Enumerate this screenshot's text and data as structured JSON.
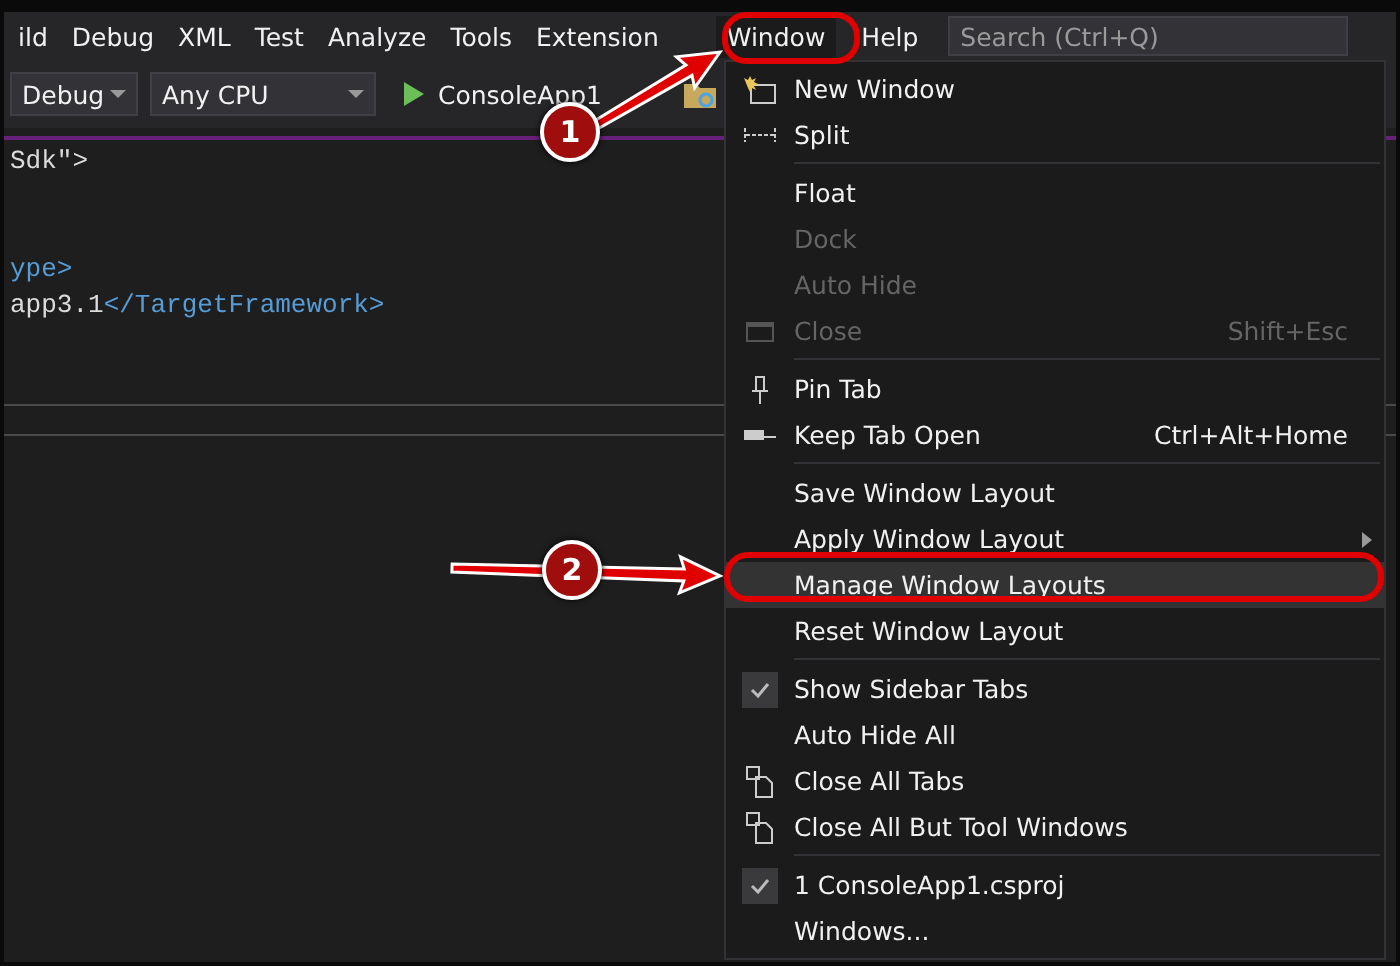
{
  "menu_bar": {
    "items": [
      {
        "label": "ild",
        "selected": false
      },
      {
        "label": "Debug",
        "selected": false
      },
      {
        "label": "XML",
        "selected": false
      },
      {
        "label": "Test",
        "selected": false
      },
      {
        "label": "Analyze",
        "selected": false
      },
      {
        "label": "Tools",
        "selected": false
      },
      {
        "label": "Extension",
        "selected": false
      },
      {
        "label": "Window",
        "selected": true
      },
      {
        "label": "Help",
        "selected": false
      }
    ],
    "search": {
      "placeholder": "Search (Ctrl+Q)"
    }
  },
  "toolbar": {
    "configuration": "Debug",
    "platform": "Any CPU",
    "start_label": "ConsoleApp1"
  },
  "editor": {
    "lines": [
      [
        {
          "kind": "text",
          "text": "Sdk\">"
        }
      ],
      [
        {
          "kind": "tag",
          "text": "ype>"
        }
      ],
      [
        {
          "kind": "text",
          "text": "app3.1"
        },
        {
          "kind": "tag",
          "text": "</TargetFramework>"
        }
      ]
    ]
  },
  "window_menu": {
    "items": [
      {
        "kind": "item",
        "label": "New Window",
        "disabled": false,
        "checked": false,
        "selected": false
      },
      {
        "kind": "item",
        "label": "Split",
        "disabled": false,
        "checked": false,
        "selected": false
      },
      {
        "kind": "separator"
      },
      {
        "kind": "item",
        "label": "Float",
        "disabled": false,
        "checked": false,
        "selected": false
      },
      {
        "kind": "item",
        "label": "Dock",
        "disabled": true,
        "checked": false,
        "selected": false
      },
      {
        "kind": "item",
        "label": "Auto Hide",
        "disabled": true,
        "checked": false,
        "selected": false
      },
      {
        "kind": "item",
        "label": "Close",
        "shortcut": "Shift+Esc",
        "disabled": true,
        "checked": false,
        "selected": false
      },
      {
        "kind": "separator"
      },
      {
        "kind": "item",
        "label": "Pin Tab",
        "disabled": false,
        "checked": false,
        "selected": false
      },
      {
        "kind": "item",
        "label": "Keep Tab Open",
        "shortcut": "Ctrl+Alt+Home",
        "disabled": false,
        "checked": false,
        "selected": false
      },
      {
        "kind": "separator"
      },
      {
        "kind": "item",
        "label": "Save Window Layout",
        "disabled": false,
        "checked": false,
        "selected": false
      },
      {
        "kind": "item",
        "label": "Apply Window Layout",
        "submenu": true,
        "disabled": false,
        "checked": false,
        "selected": false
      },
      {
        "kind": "item",
        "label": "Manage Window Layouts",
        "disabled": false,
        "checked": false,
        "selected": true
      },
      {
        "kind": "item",
        "label": "Reset Window Layout",
        "disabled": false,
        "checked": false,
        "selected": false
      },
      {
        "kind": "separator"
      },
      {
        "kind": "item",
        "label": "Show Sidebar Tabs",
        "disabled": false,
        "checked": true,
        "selected": false
      },
      {
        "kind": "item",
        "label": "Auto Hide All",
        "disabled": false,
        "checked": false,
        "selected": false
      },
      {
        "kind": "item",
        "label": "Close All Tabs",
        "disabled": false,
        "checked": false,
        "selected": false
      },
      {
        "kind": "item",
        "label": "Close All But Tool Windows",
        "disabled": false,
        "checked": false,
        "selected": false
      },
      {
        "kind": "separator"
      },
      {
        "kind": "item",
        "label": "1 ConsoleApp1.csproj",
        "disabled": false,
        "checked": true,
        "selected": false
      },
      {
        "kind": "item",
        "label": "Windows...",
        "disabled": false,
        "checked": false,
        "selected": false
      }
    ]
  },
  "annotations": [
    {
      "label": "1"
    },
    {
      "label": "2"
    }
  ]
}
